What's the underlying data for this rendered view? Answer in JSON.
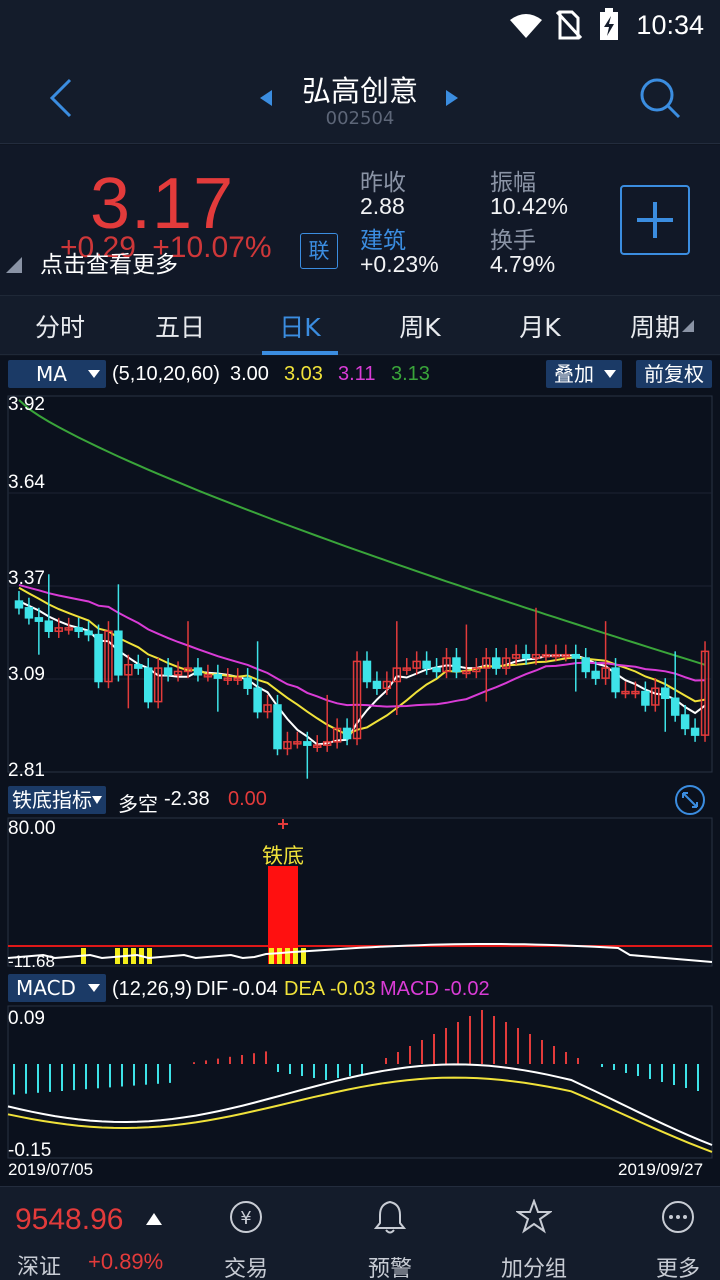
{
  "status_bar": {
    "time": "10:34"
  },
  "header": {
    "title": "弘高创意",
    "code": "002504"
  },
  "quote": {
    "price": "3.17",
    "change": "+0.29",
    "change_pct": "+10.07%",
    "tip": "点击查看更多",
    "lian": "联",
    "prev_close_label": "昨收",
    "prev_close": "2.88",
    "amplitude_label": "振幅",
    "amplitude": "10.42%",
    "sector_label": "建筑",
    "sector_change": "+0.23%",
    "turnover_label": "换手",
    "turnover": "4.79%"
  },
  "tabs": [
    "分时",
    "五日",
    "日K",
    "周K",
    "月K",
    "周期"
  ],
  "active_tab": "日K",
  "ma_bar": {
    "indicator": "MA",
    "params": "(5,10,20,60)",
    "ma5": "3.00",
    "ma10": "3.03",
    "ma20": "3.11",
    "ma60": "3.13",
    "overlay": "叠加",
    "adjust": "前复权"
  },
  "price_axis": [
    "3.92",
    "3.64",
    "3.37",
    "3.09",
    "2.81"
  ],
  "tiedi": {
    "indicator": "铁底指标",
    "duokong_label": "多空",
    "duokong_value": "-2.38",
    "value2": "0.00",
    "ymax": "80.00",
    "ymin": "-11.68",
    "signal": "铁底"
  },
  "macd_bar": {
    "indicator": "MACD",
    "params": "(12,26,9)",
    "dif_label": "DIF",
    "dif": "-0.04",
    "dea_label": "DEA",
    "dea": "-0.03",
    "macd_label": "MACD",
    "macd": "-0.02",
    "ymax": "0.09",
    "ymin": "-0.15"
  },
  "dates": {
    "start": "2019/07/05",
    "end": "2019/09/27"
  },
  "colors": {
    "up": "#e33b3b",
    "down": "#3ee3e8",
    "accent": "#3b8de0",
    "ma5": "#ffffff",
    "ma10": "#f0e23a",
    "ma20": "#d93cd6",
    "ma60": "#3aa53a"
  },
  "bottom": {
    "index_value": "9548.96",
    "index_name": "深证",
    "index_pct": "+0.89%",
    "nav": [
      "交易",
      "预警",
      "加分组",
      "更多"
    ]
  },
  "chart_data": {
    "type": "candlestick",
    "x_range": [
      "2019/07/05",
      "2019/09/27"
    ],
    "ylim": [
      2.81,
      3.92
    ],
    "closes": [
      3.3,
      3.27,
      3.26,
      3.23,
      3.24,
      3.24,
      3.23,
      3.22,
      3.08,
      3.23,
      3.1,
      3.13,
      3.12,
      3.02,
      3.12,
      3.1,
      3.11,
      3.12,
      3.1,
      3.1,
      3.09,
      3.09,
      3.09,
      3.06,
      2.99,
      3.01,
      2.88,
      2.9,
      2.9,
      2.89,
      2.89,
      2.9,
      2.94,
      2.91,
      3.14,
      3.08,
      3.06,
      3.08,
      3.12,
      3.12,
      3.14,
      3.12,
      3.11,
      3.15,
      3.11,
      3.11,
      3.12,
      3.15,
      3.12,
      3.15,
      3.16,
      3.15,
      3.16,
      3.16,
      3.16,
      3.16,
      3.15,
      3.11,
      3.09,
      3.12,
      3.05,
      3.05,
      3.05,
      3.01,
      3.06,
      3.03,
      2.98,
      2.94,
      2.92,
      3.17
    ],
    "ma_params": [
      5,
      10,
      20,
      60
    ]
  }
}
